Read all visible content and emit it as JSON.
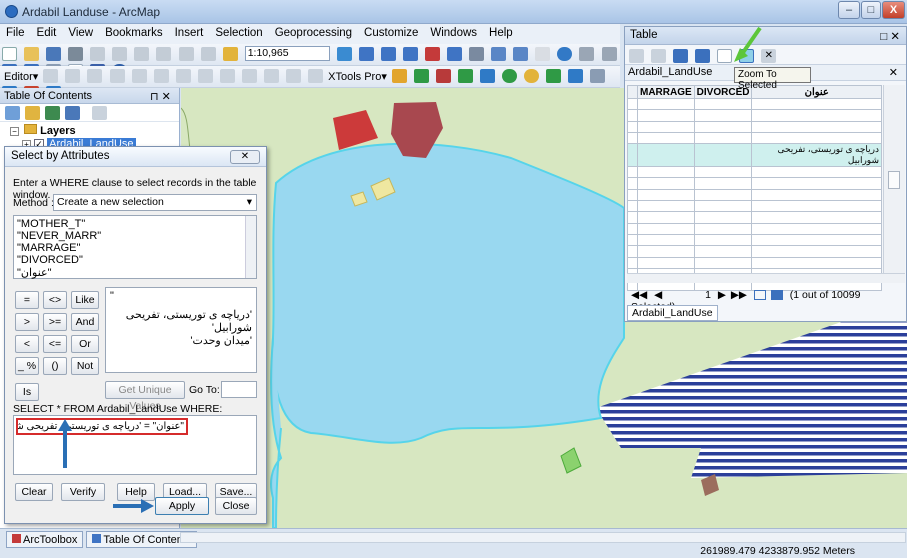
{
  "window": {
    "title": "Ardabil Landuse - ArcMap",
    "minimize": "–",
    "maximize": "□",
    "close": "X"
  },
  "menu": [
    "File",
    "Edit",
    "View",
    "Bookmarks",
    "Insert",
    "Selection",
    "Geoprocessing",
    "Customize",
    "Windows",
    "Help"
  ],
  "toolbar": {
    "scale": "1:10,965",
    "editor": "Editor▾",
    "xtools": "XTools Pro▾"
  },
  "toc": {
    "title": "Table Of Contents",
    "pin": "⊓ ✕",
    "layers_label": "Layers",
    "layer_name": "Ardabil_LandUse"
  },
  "dialog": {
    "title": "Select by Attributes",
    "close": "✕",
    "instruction": "Enter a WHERE clause to select records in the table window.",
    "method_label": "Method :",
    "method_value": "Create a new selection",
    "fields": [
      "\"MOTHER_T\"",
      "\"NEVER_MARR\"",
      "\"MARRAGE\"",
      "\"DIVORCED\"",
      "\"عنوان\""
    ],
    "operators": [
      "=",
      "<>",
      "Like",
      ">",
      ">=",
      "And",
      "<",
      "<=",
      "Or",
      "_ %",
      "()",
      "Not",
      "Is"
    ],
    "values": [
      "\"",
      "'دریاچه ی توریستی، تفریحی شورابیل'",
      "'میدان وحدت'"
    ],
    "get_unique": "Get Unique Values",
    "go_to": "Go To:",
    "select_from": "SELECT * FROM Ardabil_LandUse WHERE:",
    "expression": "\"عنوان\" = 'دریاچه ی توریستی، تفریحی شورابیل'",
    "buttons": {
      "clear": "Clear",
      "verify": "Verify",
      "help": "Help",
      "load": "Load...",
      "save": "Save...",
      "apply": "Apply",
      "close": "Close"
    }
  },
  "table": {
    "title": "Table",
    "close": "□ ✕",
    "layer_tab": "Ardabil_LandUse",
    "columns": [
      "MARRAGE",
      "DIVORCED",
      "عنوان"
    ],
    "selected_text": "دریاچه ی توریستی، تفریحی شورابیل",
    "selected_row_index": 4,
    "row_count_visible": 16,
    "nav": {
      "current": "1",
      "status": "(1 out of 10099 Selected)"
    },
    "bottom_tab": "Ardabil_LandUse"
  },
  "tooltip": "Zoom To Selected",
  "status": {
    "tab_toolbox": "ArcToolbox",
    "tab_toc": "Table Of Contents",
    "coords": "261989.479  4233879.952 Meters"
  },
  "colors": {
    "water": "#99d8f0",
    "water_edge": "#56d4ea",
    "land": "#d7e7c1",
    "red_parcel": "#cc3a3a",
    "brown_parcel": "#a8484f",
    "stripe": "#2b3f9a",
    "highlight": "#d52b2b",
    "arrow": "#2a6fb5",
    "green_arrow": "#5cc63a"
  }
}
